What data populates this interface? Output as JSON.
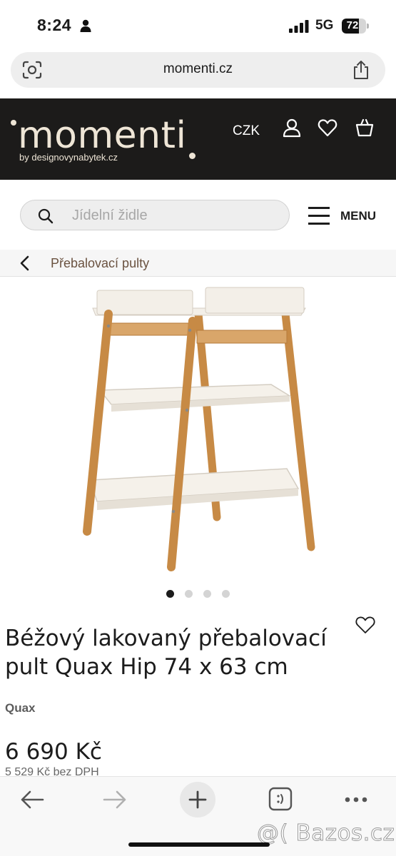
{
  "status_bar": {
    "time": "8:24",
    "network": "5G",
    "battery": "72",
    "battery_level": 0.72
  },
  "browser": {
    "url": "momenti.cz"
  },
  "header": {
    "logo_text": "momenti",
    "logo_subtitle": "by designovynabytek.cz",
    "currency": "CZK"
  },
  "search": {
    "placeholder": "Jídelní židle"
  },
  "menu": {
    "label": "MENU"
  },
  "breadcrumb": {
    "label": "Přebalovací pulty"
  },
  "carousel": {
    "count": 4,
    "active_index": 0
  },
  "product": {
    "title": "Béžový lakovaný přebalovací pult Quax Hip 74 x 63 cm",
    "brand": "Quax",
    "price": "6 690 Kč",
    "price_net": "5 529 Kč bez DPH"
  },
  "watermark": {
    "text": "@( Bazos.cz"
  },
  "colors": {
    "header_bg": "#1c1b1a",
    "logo": "#eee5d6",
    "breadcrumb_text": "#6a5240"
  }
}
